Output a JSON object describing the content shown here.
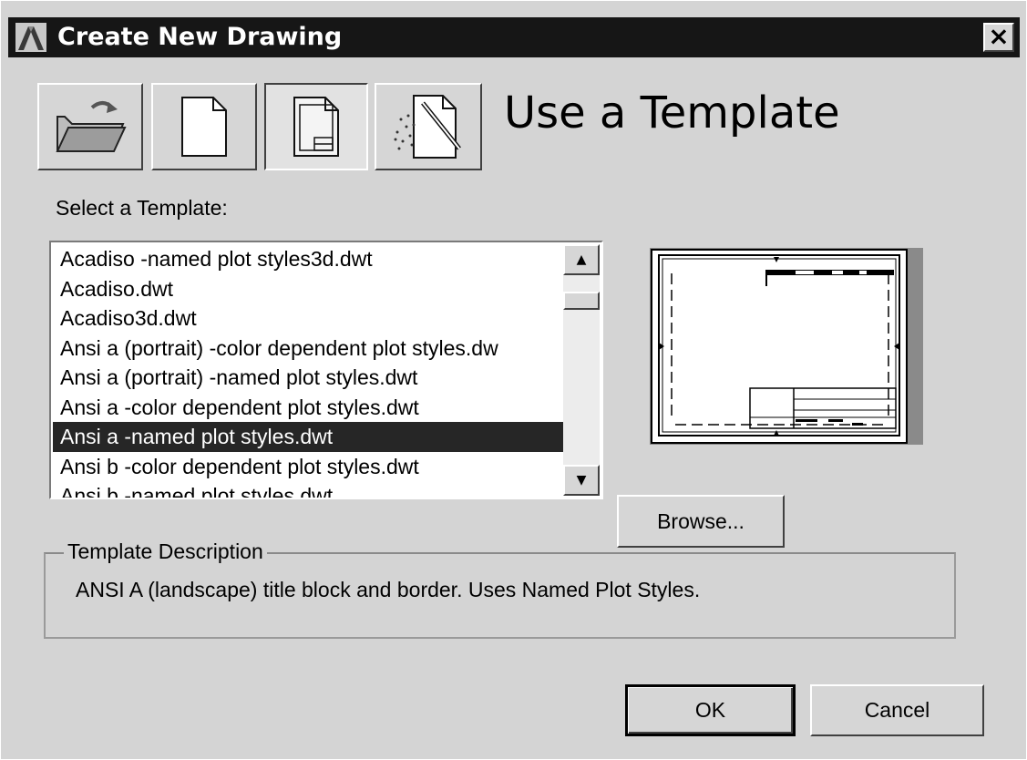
{
  "window": {
    "title": "Create New Drawing",
    "close_label": "×"
  },
  "toolbar": {
    "buttons": [
      {
        "name": "open-drawing",
        "icon": "open-folder-icon"
      },
      {
        "name": "start-from-scratch",
        "icon": "blank-page-icon"
      },
      {
        "name": "use-a-template",
        "icon": "template-page-icon",
        "pressed": true
      },
      {
        "name": "use-a-wizard",
        "icon": "wizard-wand-icon"
      }
    ]
  },
  "mode_heading": "Use a Template",
  "select_label": "Select a Template:",
  "templates": [
    "Acadiso -named plot styles3d.dwt",
    "Acadiso.dwt",
    "Acadiso3d.dwt",
    "Ansi a (portrait) -color dependent plot styles.dw",
    "Ansi a (portrait) -named plot styles.dwt",
    "Ansi a -color dependent plot styles.dwt",
    "Ansi a -named plot styles.dwt",
    "Ansi b -color dependent plot styles.dwt",
    "Ansi b -named plot styles.dwt"
  ],
  "selected_template_index": 6,
  "scroll": {
    "up_glyph": "▲",
    "down_glyph": "▼"
  },
  "browse_label": "Browse...",
  "description": {
    "group_label": "Template Description",
    "text": "ANSI A (landscape) title block and border.  Uses Named Plot Styles."
  },
  "buttons": {
    "ok": "OK",
    "cancel": "Cancel"
  },
  "colors": {
    "titlebar": "#161616",
    "selection": "#262626",
    "dialog": "#d4d4d4"
  }
}
